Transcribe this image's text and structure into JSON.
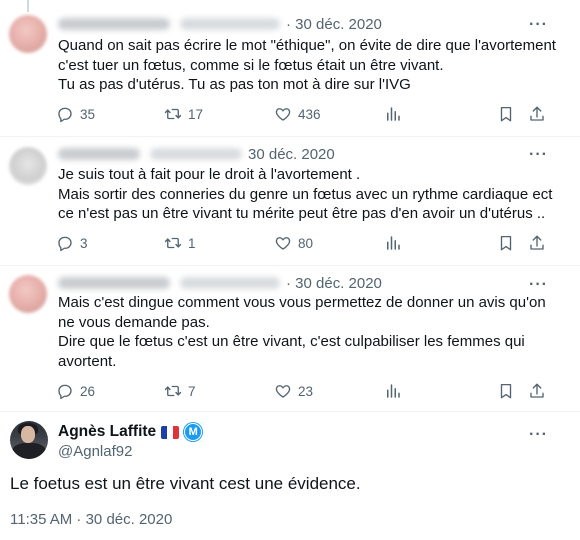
{
  "replies": [
    {
      "author_name": "",
      "author_handle": "",
      "date": "· 30 déc. 2020",
      "text": "Quand on sait pas écrire le mot \"éthique\", on évite de dire que l'avortement\nc'est tuer un fœtus, comme si le fœtus était un être vivant.\nTu as pas d'utérus. Tu as pas ton mot à dire sur l'IVG",
      "stats": {
        "replies": "35",
        "retweets": "17",
        "likes": "436"
      }
    },
    {
      "author_name": "",
      "author_handle": "",
      "date": "30 déc. 2020",
      "text": "Je suis tout à fait pour  le droit à l'avortement .\nMais sortir des conneries du genre un fœtus avec un rythme cardiaque ect\nce n'est pas un être vivant tu mérite peut être pas d'en avoir un d'utérus ..",
      "stats": {
        "replies": "3",
        "retweets": "1",
        "likes": "80"
      }
    },
    {
      "author_name": "",
      "author_handle": "",
      "date": "· 30 déc. 2020",
      "text": "Mais c'est dingue comment vous vous permettez de donner un avis qu'on\nne vous demande pas.\nDire que le fœtus c'est un être vivant, c'est culpabiliser les femmes qui\navortent.",
      "stats": {
        "replies": "26",
        "retweets": "7",
        "likes": "23"
      }
    }
  ],
  "main_tweet": {
    "author_name": "Agnès Laffite",
    "badge_letter": "M",
    "author_handle": "@Agnlaf92",
    "text": "Le foetus est un être vivant cest une évidence.",
    "timestamp": "11:35 AM · 30 déc. 2020"
  },
  "icons": {
    "reply": "reply-icon",
    "retweet": "retweet-icon",
    "like": "heart-icon",
    "views": "views-icon",
    "bookmark": "bookmark-icon",
    "share": "share-icon",
    "more": "more-icon"
  },
  "colors": {
    "text_primary": "#0f1419",
    "text_secondary": "#536471",
    "accent": "#1d9bf0",
    "divider": "#eff3f4"
  }
}
